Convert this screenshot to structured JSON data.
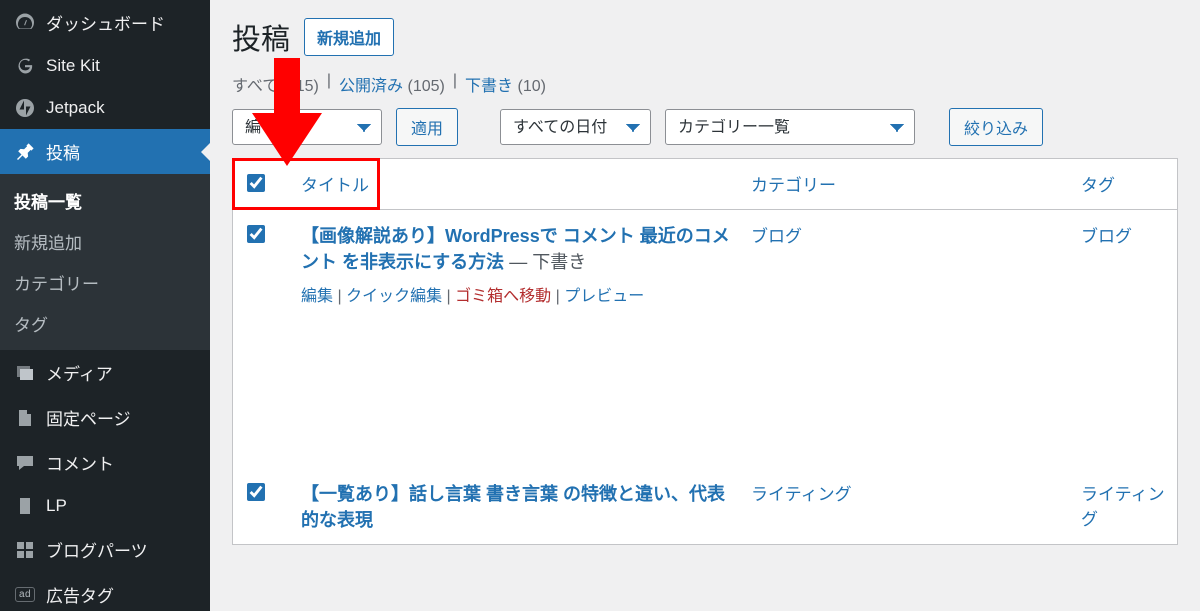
{
  "sidebar": {
    "items": [
      {
        "id": "dashboard",
        "label": "ダッシュボード"
      },
      {
        "id": "sitekit",
        "label": "Site Kit"
      },
      {
        "id": "jetpack",
        "label": "Jetpack"
      },
      {
        "id": "posts",
        "label": "投稿",
        "current": true
      },
      {
        "id": "media",
        "label": "メディア"
      },
      {
        "id": "pages",
        "label": "固定ページ"
      },
      {
        "id": "comments",
        "label": "コメント"
      },
      {
        "id": "lp",
        "label": "LP"
      },
      {
        "id": "blogparts",
        "label": "ブログパーツ"
      },
      {
        "id": "adtag",
        "label": "広告タグ"
      }
    ],
    "sub_posts": [
      {
        "label": "投稿一覧",
        "active": true
      },
      {
        "label": "新規追加"
      },
      {
        "label": "カテゴリー"
      },
      {
        "label": "タグ"
      }
    ]
  },
  "header": {
    "title": "投稿",
    "add_new": "新規追加"
  },
  "status_filters": {
    "all": {
      "label": "すべて",
      "count": "(115)"
    },
    "published": {
      "label": "公開済み",
      "count": "(105)"
    },
    "draft": {
      "label": "下書き",
      "count": "(10)"
    },
    "sep": " | "
  },
  "filters": {
    "bulk_placeholder": "編",
    "apply": "適用",
    "date": "すべての日付",
    "category": "カテゴリー一覧",
    "filter": "絞り込み"
  },
  "table": {
    "cols": {
      "title": "タイトル",
      "category": "カテゴリー",
      "tag": "タグ"
    },
    "rows": [
      {
        "title": "【画像解説あり】WordPressで コメント 最近のコメント を非表示にする方法",
        "status_suffix": " — 下書き",
        "category": "ブログ",
        "tag": "ブログ",
        "actions": {
          "edit": "編集",
          "quick": "クイック編集",
          "trash": "ゴミ箱へ移動",
          "preview": "プレビュー"
        }
      },
      {
        "title": "【一覧あり】話し言葉 書き言葉 の特徴と違い、代表的な表現",
        "status_suffix": "",
        "category": "ライティング",
        "tag": "ライティング"
      }
    ]
  }
}
